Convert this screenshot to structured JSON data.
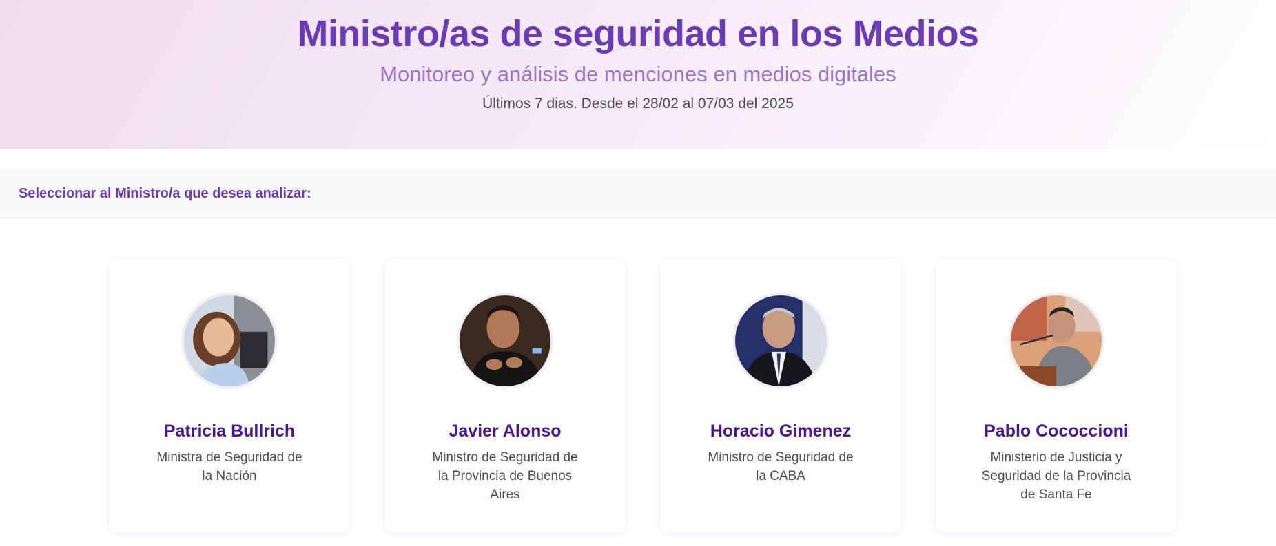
{
  "header": {
    "title": "Ministro/as de seguridad en los Medios",
    "subtitle": "Monitoreo y análisis de menciones en medios digitales",
    "date_range": "Últimos 7 dias. Desde el 28/02 al 07/03 del 2025"
  },
  "selector": {
    "label": "Seleccionar al Ministro/a que desea analizar:"
  },
  "ministers": [
    {
      "name": "Patricia Bullrich",
      "role": "Ministra de Seguridad de la Nación",
      "photo": "portrait-photo"
    },
    {
      "name": "Javier Alonso",
      "role": "Ministro de Seguridad de la Provincia de Buenos Aires",
      "photo": "portrait-photo"
    },
    {
      "name": "Horacio Gimenez",
      "role": "Ministro de Seguridad de la CABA",
      "photo": "portrait-photo"
    },
    {
      "name": "Pablo Cococcioni",
      "role": "Ministerio de Justicia y Seguridad de la Provincia de Santa Fe",
      "photo": "portrait-photo"
    }
  ],
  "colors": {
    "title": "#6a3bb5",
    "subtitle": "#9a74cf",
    "card_name": "#4c1591",
    "hero_background": "#efdcef"
  }
}
